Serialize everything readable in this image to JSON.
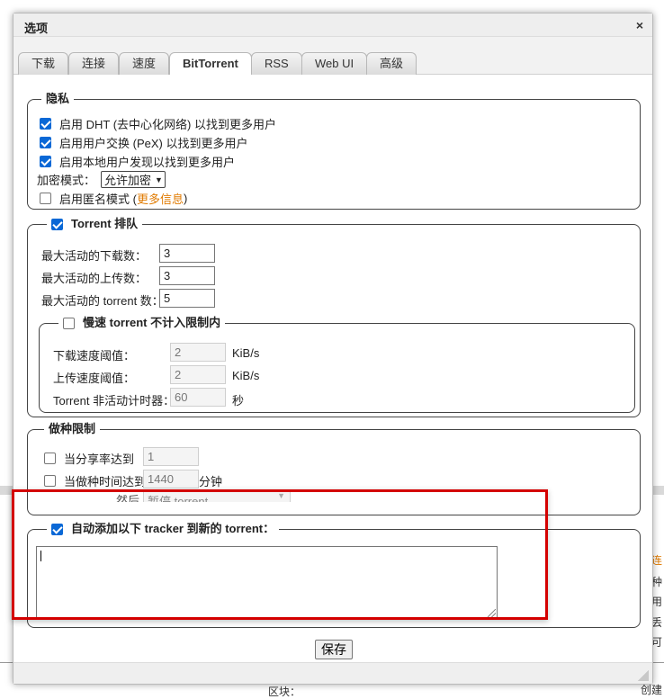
{
  "dialog": {
    "title": "选项",
    "close_symbol": "×",
    "tabs": [
      {
        "label": "下载"
      },
      {
        "label": "连接"
      },
      {
        "label": "速度"
      },
      {
        "label": "BitTorrent"
      },
      {
        "label": "RSS"
      },
      {
        "label": "Web UI"
      },
      {
        "label": "高级"
      }
    ],
    "active_tab": "BitTorrent",
    "save_label": "保存"
  },
  "privacy": {
    "legend": "隐私",
    "dht": {
      "label": "启用 DHT (去中心化网络) 以找到更多用户",
      "checked": true
    },
    "pex": {
      "label": "启用用户交换 (PeX) 以找到更多用户",
      "checked": true
    },
    "lsd": {
      "label": "启用本地用户发现以找到更多用户",
      "checked": true
    },
    "encryption_label": "加密模式：",
    "encryption_value": "允许加密",
    "anonymous": {
      "label": "启用匿名模式 (",
      "link": "更多信息",
      "suffix": ")",
      "checked": false
    }
  },
  "queue": {
    "legend": "Torrent 排队",
    "enabled": true,
    "max_downloads_label": "最大活动的下载数：",
    "max_downloads": "3",
    "max_uploads_label": "最大活动的上传数：",
    "max_uploads": "3",
    "max_torrents_label": "最大活动的 torrent 数：",
    "max_torrents": "5",
    "slow": {
      "legend": "慢速 torrent 不计入限制内",
      "enabled": false,
      "dl_label": "下载速度阈值：",
      "dl_value": "2",
      "dl_unit": "KiB/s",
      "ul_label": "上传速度阈值：",
      "ul_value": "2",
      "ul_unit": "KiB/s",
      "timer_label": "Torrent 非活动计时器：",
      "timer_value": "60",
      "timer_unit": "秒"
    }
  },
  "seeding": {
    "legend": "做种限制",
    "ratio_label": "当分享率达到",
    "ratio_value": "1",
    "time_label": "当做种时间达到",
    "time_value": "1440",
    "time_unit": "分钟",
    "then_label": "然后",
    "then_value": "暂停 torrent"
  },
  "trackers": {
    "legend": "自动添加以下 tracker 到新的 torrent：",
    "enabled": true,
    "value": ""
  },
  "background": {
    "frag1": "连",
    "frag2": "种",
    "frag3": "用",
    "frag4": "丢",
    "frag5": "可",
    "frag6": "区块：",
    "frag7": "创建"
  },
  "colors": {
    "accent": "#e07a00",
    "checkbox": "#0a68d6",
    "highlight": "#d40000"
  }
}
